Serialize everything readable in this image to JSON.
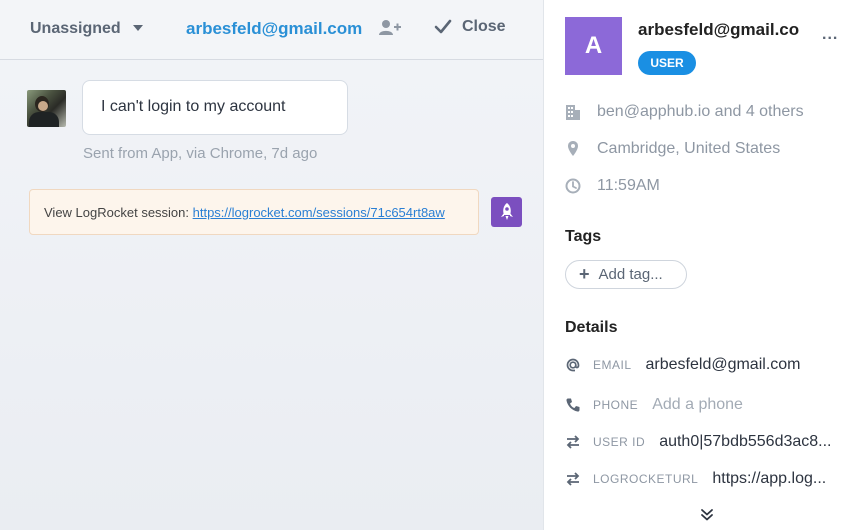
{
  "conversation": {
    "assignee_label": "Unassigned",
    "contact_email": "arbesfeld@gmail.com",
    "close_label": "Close",
    "message": {
      "text": "I can't login to my account",
      "meta": "Sent from App, via Chrome, 7d ago"
    },
    "logrocket": {
      "prefix": "View LogRocket session: ",
      "link": "https://logrocket.com/sessions/71c654rt8aw"
    }
  },
  "profile": {
    "avatar_letter": "A",
    "name": "arbesfeld@gmail.co",
    "role": "USER",
    "more_label": "...",
    "company": "ben@apphub.io and 4 others",
    "location": "Cambridge, United States",
    "local_time": "11:59AM",
    "tags_title": "Tags",
    "add_tag_label": "Add tag...",
    "details_title": "Details",
    "details": [
      {
        "key": "EMAIL",
        "value": "arbesfeld@gmail.com",
        "icon": "at-icon"
      },
      {
        "key": "PHONE",
        "value": "Add a phone",
        "icon": "phone-icon"
      },
      {
        "key": "USER ID",
        "value": "auth0|57bdb556d3ac8...",
        "icon": "swap-icon"
      },
      {
        "key": "LOGROCKETURL",
        "value": "https://app.log...",
        "icon": "swap-icon"
      }
    ]
  },
  "colors": {
    "accent": "#2a90d6",
    "avatar": "#8c69d8",
    "badge": "#1a8fe3",
    "logrocket": "#7b4fbf"
  }
}
